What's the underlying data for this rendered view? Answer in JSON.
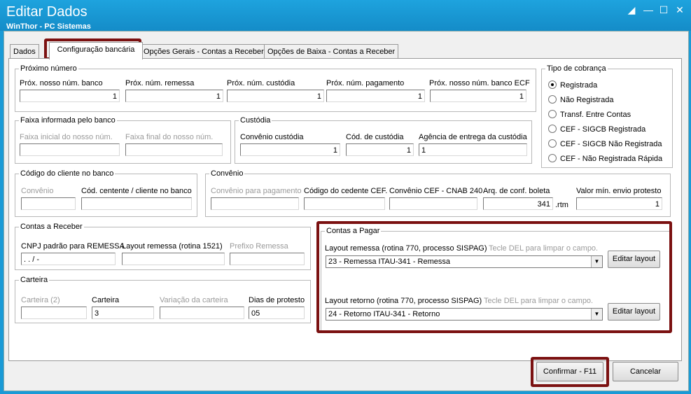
{
  "window": {
    "title": "Editar Dados",
    "subtitle": "WinThor - PC Sistemas"
  },
  "tabs": [
    "Dados",
    "Configuração bancária",
    "Opções Gerais - Contas a Receber",
    "Opções de Baixa - Contas a Receber"
  ],
  "proximo_numero": {
    "legend": "Próximo número",
    "fields": [
      {
        "label": "Próx. nosso núm. banco",
        "value": "1"
      },
      {
        "label": "Próx. núm. remessa",
        "value": "1"
      },
      {
        "label": "Próx. núm. custódia",
        "value": "1"
      },
      {
        "label": "Próx. núm. pagamento",
        "value": "1"
      },
      {
        "label": "Próx. nosso núm. banco ECF",
        "value": "1"
      }
    ]
  },
  "tipo_cobranca": {
    "legend": "Tipo de cobrança",
    "options": [
      "Registrada",
      "Não Registrada",
      "Transf. Entre Contas",
      "CEF - SIGCB Registrada",
      "CEF - SIGCB Não Registrada",
      "CEF - Não Registrada Rápida"
    ],
    "selected": "Registrada"
  },
  "faixa": {
    "legend": "Faixa informada pelo banco",
    "inicial_label": "Faixa inicial do nosso núm.",
    "final_label": "Faixa final do nosso núm."
  },
  "custodia": {
    "legend": "Custódia",
    "convenio_label": "Convênio custódia",
    "convenio_value": "1",
    "cod_label": "Cód. de custódia",
    "cod_value": "1",
    "agencia_label": "Agência de entrega da custódia",
    "agencia_value": "1"
  },
  "codigo_cliente": {
    "legend": "Código do cliente no banco",
    "convenio_label": "Convênio",
    "cedente_label": "Cód. centente / cliente no banco"
  },
  "convenio": {
    "legend": "Convênio",
    "pagamento_label": "Convênio para pagamento",
    "cedente_label": "Código do cedente CEF.",
    "cnab_label": "Convênio CEF - CNAB 240",
    "arq_label": "Arq. de conf. boleta",
    "arq_value": "341",
    "arq_ext": ".rtm",
    "valor_label": "Valor mín. envio protesto",
    "valor_value": "1"
  },
  "contas_receber": {
    "legend": "Contas a Receber",
    "cnpj_label": "CNPJ padrão para REMESSA",
    "cnpj_value": " .  .  /    -",
    "layout_label": "Layout remessa (rotina 1521)",
    "prefixo_label": "Prefixo Remessa"
  },
  "carteira": {
    "legend": "Carteira",
    "carteira2_label": "Carteira (2)",
    "carteira_label": "Carteira",
    "carteira_value": "3",
    "variacao_label": "Variação da carteira",
    "dias_label": "Dias de protesto",
    "dias_value": "05"
  },
  "contas_pagar": {
    "legend": "Contas a Pagar",
    "remessa_label": "Layout remessa (rotina 770, processo SISPAG)",
    "remessa_hint": "Tecle DEL para limpar o campo.",
    "remessa_value": "23 - Remessa ITAU-341 - Remessa",
    "retorno_label": "Layout retorno (rotina 770, processo SISPAG)",
    "retorno_hint": "Tecle DEL para limpar o campo.",
    "retorno_value": "24 - Retorno ITAU-341 - Retorno",
    "editar_label": "Editar layout"
  },
  "footer": {
    "confirmar": "Confirmar - F11",
    "cancelar": "Cancelar"
  }
}
